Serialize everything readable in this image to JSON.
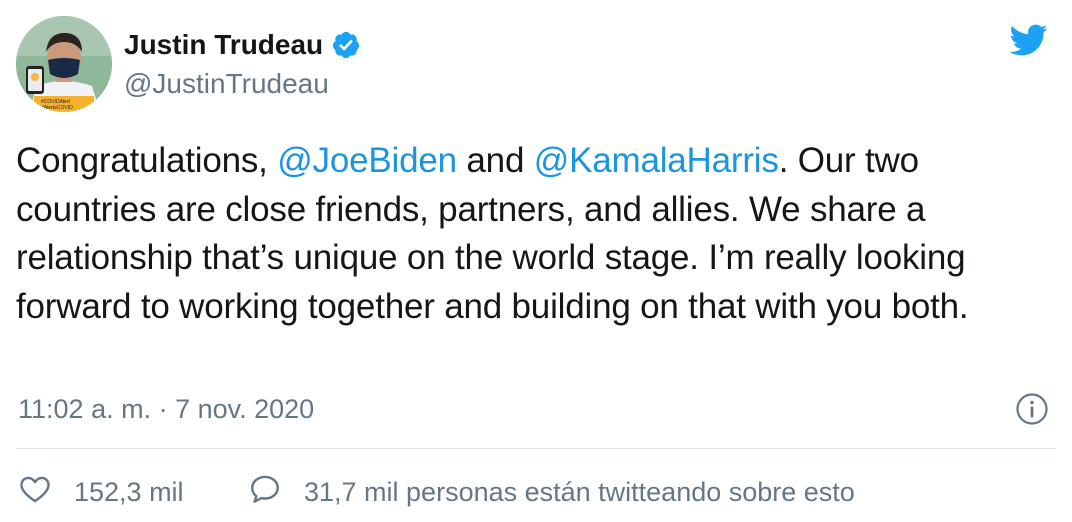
{
  "author": {
    "display_name": "Justin Trudeau",
    "handle": "@JustinTrudeau",
    "verified": true,
    "avatar_badge_line1": "#COVIDAlert",
    "avatar_badge_line2": "#AlerteCOVID"
  },
  "tweet": {
    "text_parts": {
      "p1": "Congratulations, ",
      "m1": "@JoeBiden",
      "p2": " and ",
      "m2": "@KamalaHarris",
      "p3": ". Our two countries are close friends, partners, and allies. We share a relationship that’s unique on the world stage. I’m really looking forward to working together and building on that with you both."
    },
    "timestamp": "11:02 a. m. · 7 nov. 2020"
  },
  "actions": {
    "likes": "152,3 mil",
    "conversation": "31,7 mil personas están twitteando sobre esto"
  },
  "colors": {
    "brand": "#1da1f2",
    "mention": "#1b95e0",
    "secondary_text": "#657786"
  },
  "icons": {
    "logo": "twitter-bird-icon",
    "verified": "verified-badge-icon",
    "info": "info-icon",
    "like": "heart-icon",
    "reply": "speech-bubble-icon"
  }
}
